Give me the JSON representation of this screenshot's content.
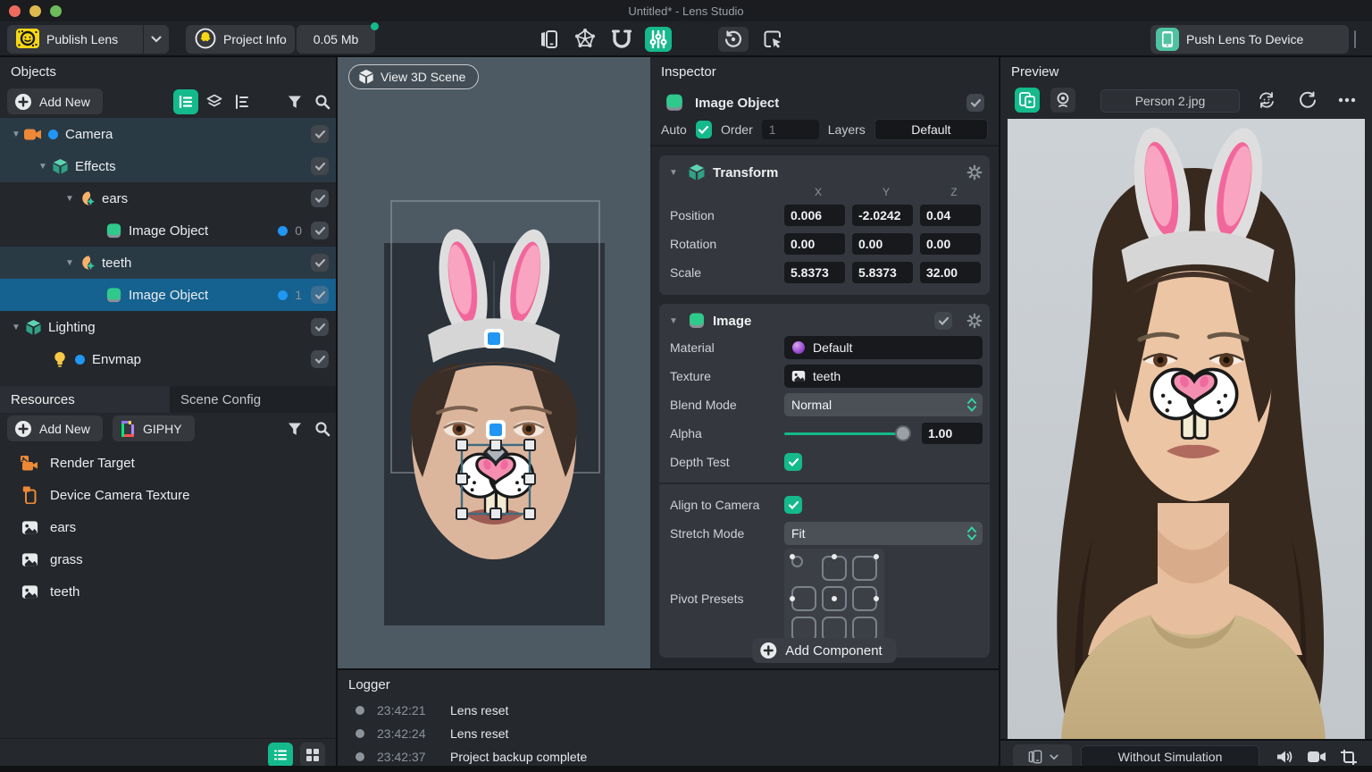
{
  "titlebar": {
    "title": "Untitled* - Lens Studio"
  },
  "toolbar": {
    "publish_label": "Publish Lens",
    "project_info_label": "Project Info",
    "project_size": "0.05 Mb",
    "push_label": "Push Lens To Device"
  },
  "objects": {
    "title": "Objects",
    "add_new_label": "Add New",
    "tree": [
      {
        "label": "Camera",
        "depth": 0,
        "icon": "camera",
        "twisty": true,
        "leftDot": true,
        "tint": true
      },
      {
        "label": "Effects",
        "depth": 1,
        "icon": "cube",
        "twisty": true,
        "tint": true
      },
      {
        "label": "ears",
        "depth": 2,
        "icon": "face",
        "twisty": true
      },
      {
        "label": "Image Object",
        "depth": 3,
        "icon": "image",
        "rightDot": true,
        "badge": "0"
      },
      {
        "label": "teeth",
        "depth": 2,
        "icon": "face",
        "twisty": true,
        "tint": true
      },
      {
        "label": "Image Object",
        "depth": 3,
        "icon": "image",
        "rightDot": true,
        "badge": "1",
        "selected": true
      },
      {
        "label": "Lighting",
        "depth": 0,
        "icon": "cube",
        "twisty": true
      },
      {
        "label": "Envmap",
        "depth": 1,
        "icon": "bulb",
        "leftDot": true
      }
    ]
  },
  "resources": {
    "tab_active": "Resources",
    "tab_inactive": "Scene Config",
    "add_new_label": "Add New",
    "giphy_label": "GIPHY",
    "items": [
      {
        "label": "Render Target",
        "icon": "render-target"
      },
      {
        "label": "Device Camera Texture",
        "icon": "device-camera"
      },
      {
        "label": "ears",
        "icon": "picture"
      },
      {
        "label": "grass",
        "icon": "picture"
      },
      {
        "label": "teeth",
        "icon": "picture"
      }
    ]
  },
  "scene": {
    "view_button_label": "View 3D Scene"
  },
  "inspector": {
    "title": "Inspector",
    "object_name": "Image Object",
    "auto_label": "Auto",
    "order_label": "Order",
    "order_value": "1",
    "layers_label": "Layers",
    "layers_value": "Default",
    "transform": {
      "title": "Transform",
      "axes": [
        "X",
        "Y",
        "Z"
      ],
      "rows": [
        {
          "label": "Position",
          "values": [
            "0.006",
            "-2.0242",
            "0.04"
          ]
        },
        {
          "label": "Rotation",
          "values": [
            "0.00",
            "0.00",
            "0.00"
          ]
        },
        {
          "label": "Scale",
          "values": [
            "5.8373",
            "5.8373",
            "32.00"
          ]
        }
      ]
    },
    "image": {
      "title": "Image",
      "material_label": "Material",
      "material_value": "Default",
      "texture_label": "Texture",
      "texture_value": "teeth",
      "blend_label": "Blend Mode",
      "blend_value": "Normal",
      "alpha_label": "Alpha",
      "alpha_value": "1.00",
      "depth_label": "Depth Test",
      "align_label": "Align to Camera",
      "stretch_label": "Stretch Mode",
      "stretch_value": "Fit",
      "pivot_label": "Pivot Presets"
    },
    "add_component_label": "Add Component"
  },
  "logger": {
    "title": "Logger",
    "entries": [
      {
        "time": "23:42:21",
        "message": "Lens reset"
      },
      {
        "time": "23:42:24",
        "message": "Lens reset"
      },
      {
        "time": "23:42:37",
        "message": "Project backup complete"
      }
    ]
  },
  "preview": {
    "title": "Preview",
    "source_value": "Person 2.jpg",
    "simulation_value": "Without Simulation"
  },
  "colors": {
    "accent": "#14b98c",
    "selection": "#15618f",
    "scene_bg": "#4e5a63"
  }
}
